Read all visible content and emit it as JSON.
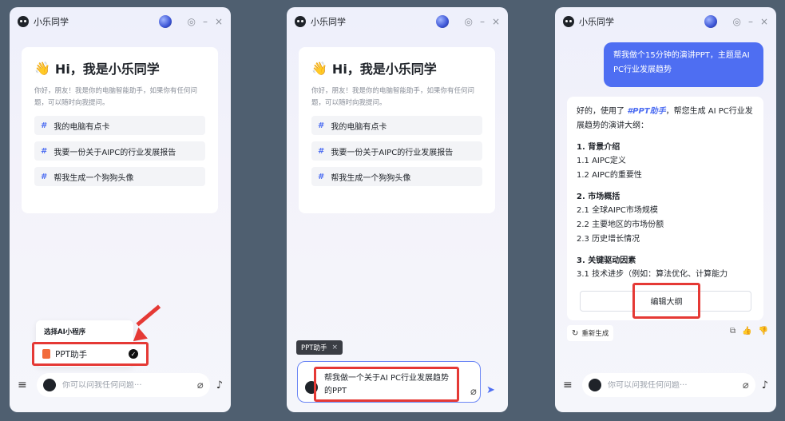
{
  "app": {
    "name": "小乐同学",
    "min_glyph": "–",
    "close_glyph": "×",
    "settings_glyph": "◎"
  },
  "welcome": {
    "wave_emoji": "👋",
    "greeting": "Hi，我是小乐同学",
    "intro": "你好，朋友！我是你的电脑智能助手，如果你有任何问题，可以随时向我提问。",
    "suggestions": [
      "我的电脑有点卡",
      "我要一份关于AIPC的行业发展报告",
      "帮我生成一个狗狗头像"
    ]
  },
  "input": {
    "placeholder": "你可以问我任何问题···"
  },
  "popup": {
    "title": "选择AI小程序",
    "option": "PPT助手",
    "check": "✓"
  },
  "compose": {
    "tag": "PPT助手",
    "tag_close": "×",
    "text": "帮我做一个关于AI PC行业发展趋势的PPT"
  },
  "chat": {
    "user_message": "帮我做个15分钟的演讲PPT，主题是AI PC行业发展趋势",
    "answer_prefix": "好的，使用了 ",
    "answer_tool": "#PPT助手",
    "answer_suffix": "，帮您生成 AI PC行业发展趋势的演讲大纲：",
    "sections": [
      {
        "title": "1. 背景介绍",
        "items": [
          "1.1 AIPC定义",
          "1.2 AIPC的重要性"
        ]
      },
      {
        "title": "2. 市场概括",
        "items": [
          "2.1 全球AIPC市场规模",
          "2.2 主要地区的市场份额",
          "2.3 历史增长情况"
        ]
      },
      {
        "title": "3. 关键驱动因素",
        "items": [
          "3.1 技术进步（例如：算法优化、计算能力"
        ]
      }
    ],
    "edit_button": "编辑大纲",
    "regenerate": "重新生成"
  },
  "icons": {
    "menu": "≡",
    "clip": "⌀",
    "mic": "♪",
    "send": "➤",
    "regen": "↻",
    "copy": "⧉",
    "like": "👍",
    "dislike": "👎",
    "hash": "#"
  }
}
